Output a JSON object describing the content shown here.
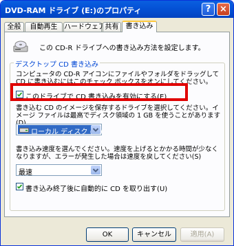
{
  "window": {
    "title": "DVD-RAM ドライブ (E:)のプロパティ",
    "help_label": "?",
    "close_label": "×"
  },
  "tabs": [
    {
      "label": "全般"
    },
    {
      "label": "自動再生"
    },
    {
      "label": "ハードウェア"
    },
    {
      "label": "共有"
    },
    {
      "label": "書き込み"
    }
  ],
  "panel": {
    "intro": "この CD-R ドライブへの書き込み方法を設定します。",
    "group_title": "デスクトップ CD 書き込み",
    "desc1": "コンピュータの CD-R アイコンにファイルやフォルダをドラッグして CD に書き込むにはこのチェック ボックスをオンにしてください。",
    "enable_label": "このドライブで CD 書き込みを有効にする(E)",
    "enable_checked": true,
    "desc2": "書き込む CD のイメージを保存するドライブを選択してください。イメージ ファイルは最高でディスク領域の 1 GB を使うことがあります(D)",
    "drive_value": "ローカル ディスク (C:)",
    "desc3": "書き込み速度を選んでください。速度を上げるとかかる時間が少なくなりますが、エラーが発生した場合は速度を戻してください(S)",
    "speed_value": "最速",
    "eject_label": "書き込み終了後に自動的に CD を取り出す(U)",
    "eject_checked": true
  },
  "buttons": {
    "ok": "OK",
    "cancel": "キャンセル",
    "apply": "適用(A)"
  },
  "colors": {
    "titlebar": "#0450D4",
    "highlight_border": "#E00000",
    "group_title": "#0046D5",
    "selection": "#316AC5"
  }
}
